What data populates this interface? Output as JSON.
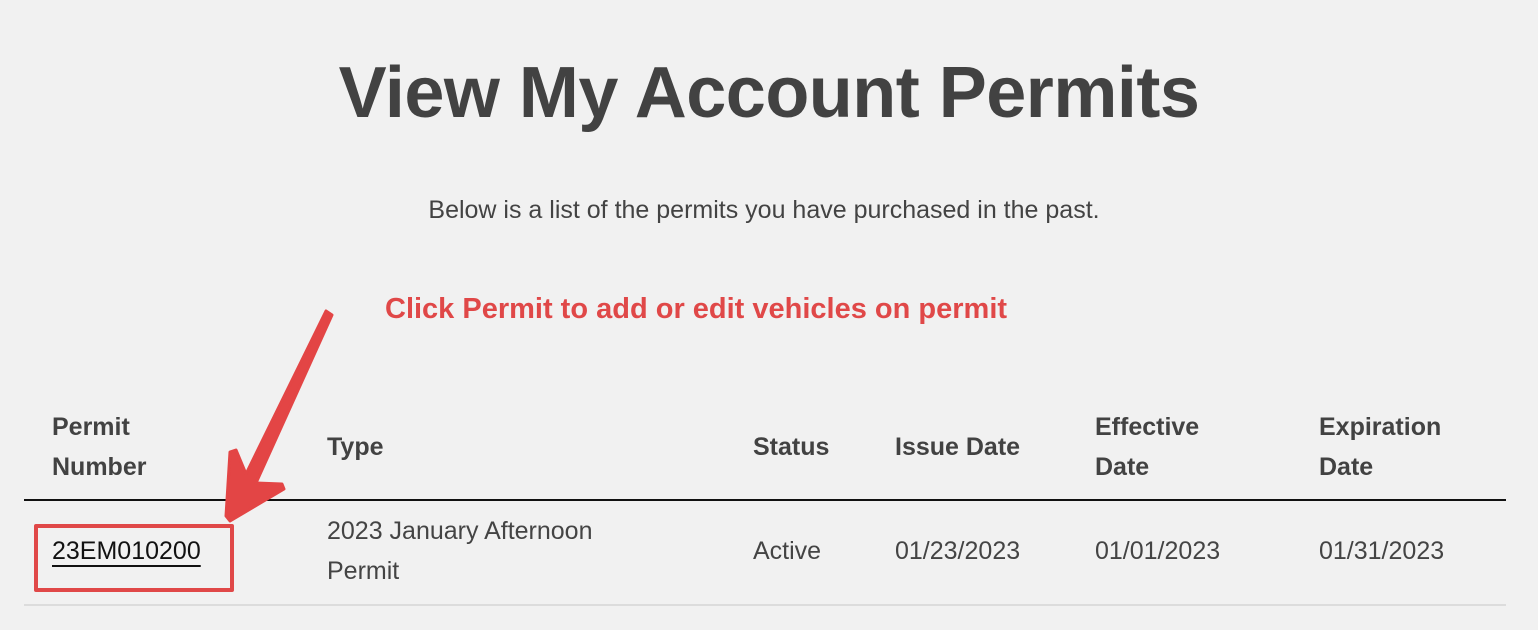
{
  "page": {
    "title": "View My Account Permits",
    "subtitle": "Below is a list of the permits you have purchased in the past.",
    "annotation": "Click Permit to add or edit vehicles on permit",
    "annotation_color": "#e04848"
  },
  "table": {
    "headers": [
      "Permit\nNumber",
      "Type",
      "Status",
      "Issue Date",
      "Effective\nDate",
      "Expiration\nDate"
    ],
    "header_lines": [
      [
        "Permit",
        "Number"
      ],
      [
        "Type"
      ],
      [
        "Status"
      ],
      [
        "Issue Date"
      ],
      [
        "Effective",
        "Date"
      ],
      [
        "Expiration",
        "Date"
      ]
    ],
    "rows": [
      {
        "permit_number": "23EM010200",
        "type_lines": [
          "2023 January Afternoon",
          "Permit"
        ],
        "type": "2023 January Afternoon Permit",
        "status": "Active",
        "issue_date": "01/23/2023",
        "effective_date": "01/01/2023",
        "expiration_date": "01/31/2023"
      }
    ]
  }
}
